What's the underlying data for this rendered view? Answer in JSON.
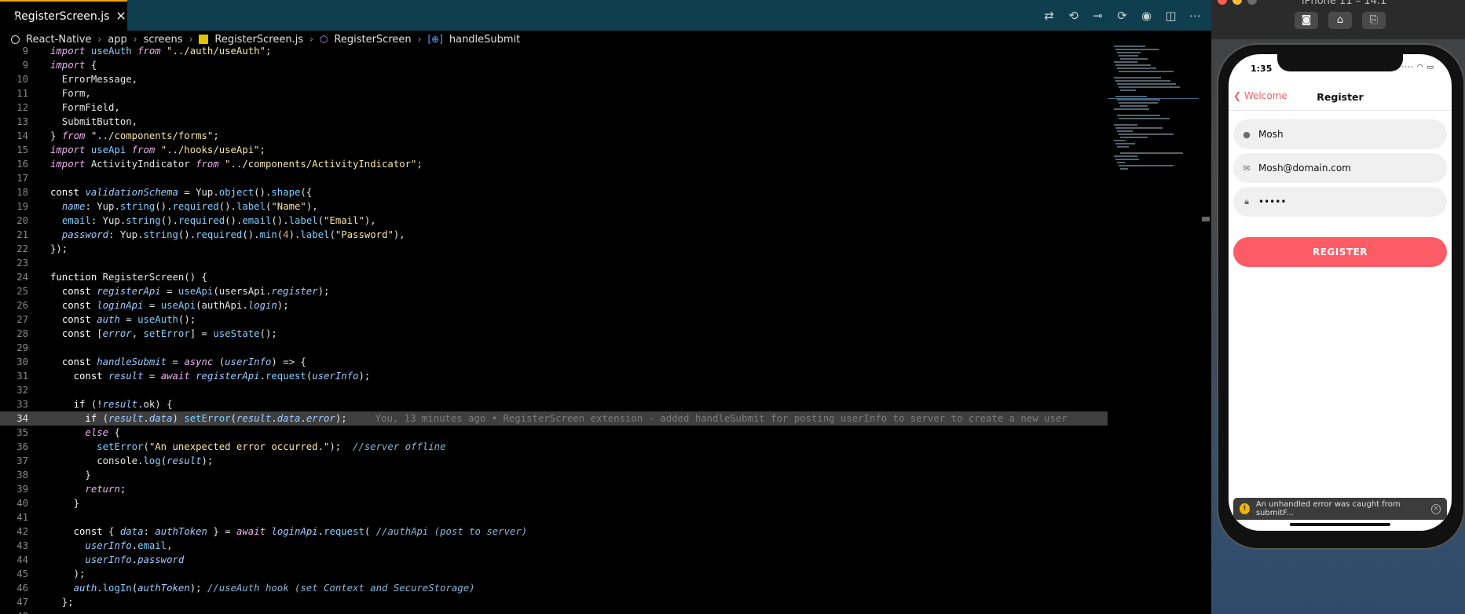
{
  "tab": {
    "file": "RegisterScreen.js",
    "close": "✕"
  },
  "toolbar_icons": [
    "git-compare-icon",
    "go-back-icon",
    "git-commit-icon",
    "go-forward-icon",
    "timeline-icon",
    "split-editor-icon",
    "more-icon"
  ],
  "breadcrumb": [
    "React-Native",
    "app",
    "screens",
    "RegisterScreen.js",
    "RegisterScreen",
    "handleSubmit"
  ],
  "code_lines": [
    {
      "n": "9",
      "t": "import useAuth from \"../auth/useAuth\";"
    },
    {
      "n": "9",
      "t": "import {"
    },
    {
      "n": "10",
      "t": "  ErrorMessage,"
    },
    {
      "n": "11",
      "t": "  Form,"
    },
    {
      "n": "12",
      "t": "  FormField,"
    },
    {
      "n": "13",
      "t": "  SubmitButton,"
    },
    {
      "n": "14",
      "t": "} from \"../components/forms\";"
    },
    {
      "n": "15",
      "t": "import useApi from \"../hooks/useApi\";"
    },
    {
      "n": "16",
      "t": "import ActivityIndicator from \"../components/ActivityIndicator\";"
    },
    {
      "n": "17",
      "t": ""
    },
    {
      "n": "18",
      "t": "const validationSchema = Yup.object().shape({"
    },
    {
      "n": "19",
      "t": "  name: Yup.string().required().label(\"Name\"),"
    },
    {
      "n": "20",
      "t": "  email: Yup.string().required().email().label(\"Email\"),"
    },
    {
      "n": "21",
      "t": "  password: Yup.string().required().min(4).label(\"Password\"),"
    },
    {
      "n": "22",
      "t": "});"
    },
    {
      "n": "23",
      "t": ""
    },
    {
      "n": "24",
      "t": "function RegisterScreen() {"
    },
    {
      "n": "25",
      "t": "  const registerApi = useApi(usersApi.register);"
    },
    {
      "n": "26",
      "t": "  const loginApi = useApi(authApi.login);"
    },
    {
      "n": "27",
      "t": "  const auth = useAuth();"
    },
    {
      "n": "28",
      "t": "  const [error, setError] = useState();"
    },
    {
      "n": "29",
      "t": ""
    },
    {
      "n": "30",
      "t": "  const handleSubmit = async (userInfo) => {"
    },
    {
      "n": "31",
      "t": "    const result = await registerApi.request(userInfo);"
    },
    {
      "n": "32",
      "t": ""
    },
    {
      "n": "33",
      "t": "    if (!result.ok) {"
    },
    {
      "n": "34",
      "t": "      if (result.data) setError(result.data.error);"
    },
    {
      "n": "35",
      "t": "      else {"
    },
    {
      "n": "36",
      "t": "        setError(\"An unexpected error occurred.\");  //server offline"
    },
    {
      "n": "37",
      "t": "        console.log(result);"
    },
    {
      "n": "38",
      "t": "      }"
    },
    {
      "n": "39",
      "t": "      return;"
    },
    {
      "n": "40",
      "t": "    }"
    },
    {
      "n": "41",
      "t": ""
    },
    {
      "n": "42",
      "t": "    const { data: authToken } = await loginApi.request( //authApi (post to server)"
    },
    {
      "n": "43",
      "t": "      userInfo.email,"
    },
    {
      "n": "44",
      "t": "      userInfo.password"
    },
    {
      "n": "45",
      "t": "    );"
    },
    {
      "n": "46",
      "t": "    auth.logIn(authToken); //useAuth hook (set Context and SecureStorage)"
    },
    {
      "n": "47",
      "t": "  };"
    },
    {
      "n": "48",
      "t": ""
    }
  ],
  "blame": "You, 13 minutes ago • RegisterScreen extension - added handleSubmit for posting userInfo to server to create a new user",
  "simulator": {
    "title": "iPhone 11 – 14.1",
    "buttons": [
      "screenshot-icon",
      "home-icon",
      "rotate-icon"
    ],
    "clock": "1:35",
    "back_label": "Welcome",
    "nav_title": "Register",
    "fields": [
      {
        "icon": "account-icon",
        "value": "Mosh"
      },
      {
        "icon": "email-icon",
        "value": "Mosh@domain.com"
      },
      {
        "icon": "lock-icon",
        "value": "•••••"
      }
    ],
    "register_label": "REGISTER",
    "toast": "An unhandled error was caught from submitF..."
  },
  "colors": {
    "accent": "#fc5c65",
    "tabbar": "#0f3e4f",
    "highlight": "#3f3f3f"
  }
}
